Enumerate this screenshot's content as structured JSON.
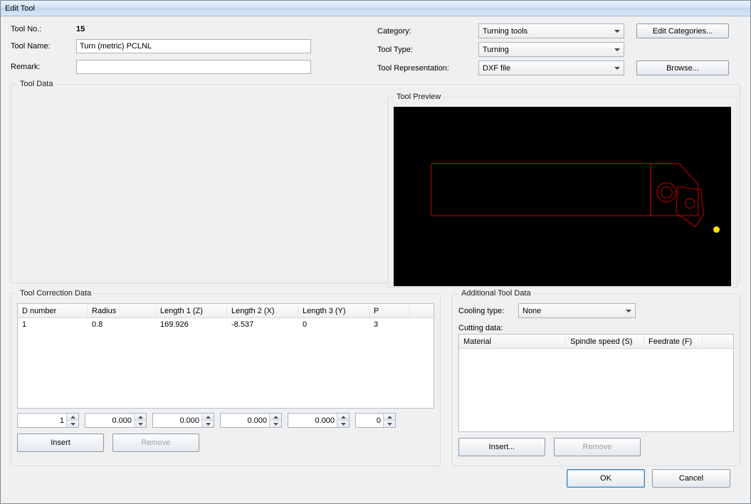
{
  "window_title": "Edit Tool",
  "labels": {
    "tool_no": "Tool No.:",
    "tool_name": "Tool Name:",
    "remark": "Remark:",
    "category": "Category:",
    "tool_type": "Tool Type:",
    "tool_repr": "Tool Representation:",
    "tool_data_group": "Tool Data",
    "tool_preview_group": "Tool Preview",
    "tool_correction_group": "Tool Correction Data",
    "additional_group": "Additional Tool Data",
    "cooling_type": "Cooling type:",
    "cutting_data": "Cutting data:"
  },
  "values": {
    "tool_no": "15",
    "tool_name": "Turn (metric) PCLNL",
    "remark": "",
    "category_selected": "Turning tools",
    "tool_type_selected": "Turning",
    "tool_repr_selected": "DXF file",
    "cooling_selected": "None"
  },
  "buttons": {
    "edit_categories": "Edit Categories...",
    "browse": "Browse...",
    "insert": "Insert",
    "remove": "Remove",
    "insert2": "Insert...",
    "remove2": "Remove",
    "ok": "OK",
    "cancel": "Cancel"
  },
  "correction_table": {
    "headers": [
      "D number",
      "Radius",
      "Length 1 (Z)",
      "Length 2 (X)",
      "Length 3 (Y)",
      "P"
    ],
    "widths": [
      98,
      96,
      100,
      100,
      100,
      56
    ],
    "rows": [
      [
        "1",
        "0.8",
        "169.926",
        "-8.537",
        "0",
        "3"
      ]
    ]
  },
  "spinners": [
    "1",
    "0.000",
    "0.000",
    "0.000",
    "0.000",
    "0"
  ],
  "spinner_widths": [
    68,
    68,
    68,
    68,
    68,
    38
  ],
  "cutting_table": {
    "headers": [
      "Material",
      "Spindle speed (S)",
      "Feedrate (F)"
    ],
    "widths": [
      150,
      110,
      82
    ]
  }
}
